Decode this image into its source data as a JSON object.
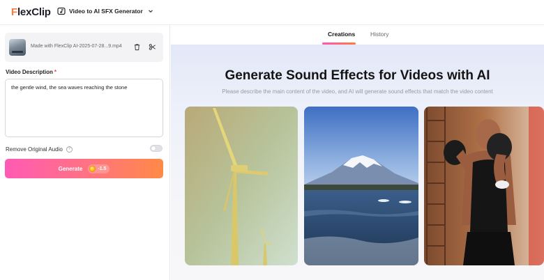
{
  "brand": {
    "name_part1": "Flex",
    "name_part2": "Clip",
    "accent": "#ff7a3d"
  },
  "tool": {
    "name": "Video to AI SFX Generator",
    "icon": "video-music-icon",
    "dropdown_icon": "chevron-down-icon"
  },
  "upload": {
    "file_name": "Made with FlexClip AI-2025-07-28...9.mp4",
    "actions": {
      "delete_icon": "trash-icon",
      "cut_icon": "scissors-icon"
    }
  },
  "form": {
    "description_label": "Video Description",
    "required_mark": "*",
    "description_value": "the gentle wind, the sea waves reaching the stone",
    "remove_audio_label": "Remove Original Audio",
    "help_mark": "?",
    "remove_audio_enabled": false
  },
  "generate": {
    "label": "Generate",
    "credit_cost": "-1.5",
    "gradient": [
      "#ff5ab4",
      "#ff8a46"
    ]
  },
  "tabs": [
    {
      "label": "Creations",
      "active": true
    },
    {
      "label": "History",
      "active": false
    }
  ],
  "hero": {
    "title": "Generate Sound Effects for Videos with AI",
    "subtitle": "Please describe the main content of the video, and AI will generate sound effects that match the video content"
  },
  "examples": [
    {
      "subject": "wind-turbines"
    },
    {
      "subject": "mount-fuji-lake"
    },
    {
      "subject": "boxer-training"
    }
  ]
}
